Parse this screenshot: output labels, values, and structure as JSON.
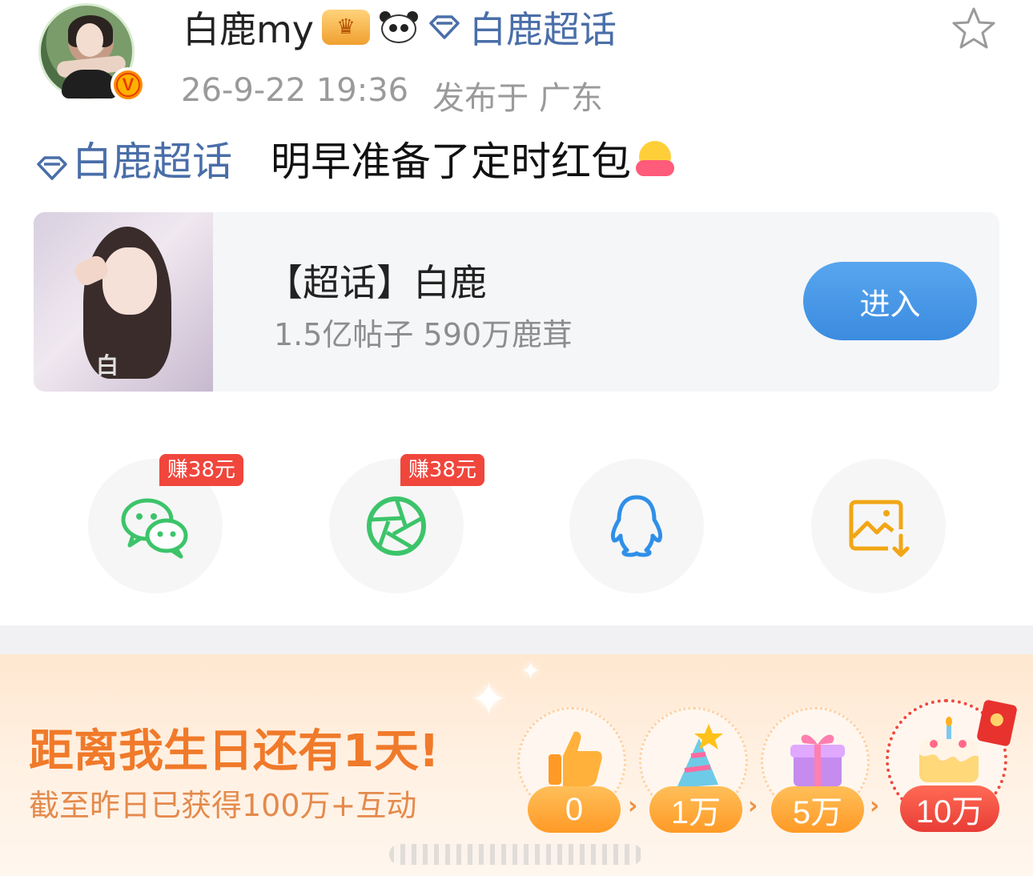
{
  "post": {
    "username": "白鹿my",
    "vip_badge_icon": "vip-crown-badge-icon",
    "panda_badge_icon": "panda-badge-icon",
    "topic_icon": "diamond-icon",
    "topic_name": "白鹿超话",
    "timestamp": "26-9-22 19:36",
    "location": "发布于 广东",
    "verified_badge": "V",
    "body_topic": "白鹿超话",
    "body_text": "明早准备了定时红包",
    "emoji_icon": "hugging-face-icon"
  },
  "card": {
    "title": "【超话】白鹿",
    "stats": "1.5亿帖子 590万鹿茸",
    "thumb_watermark": "白",
    "enter_label": "进入"
  },
  "share": {
    "items": [
      {
        "name": "wechat",
        "icon": "wechat-icon",
        "tag": "赚38元",
        "color": "#3cc46a"
      },
      {
        "name": "moments",
        "icon": "moments-shutter-icon",
        "tag": "赚38元",
        "color": "#3cc46a"
      },
      {
        "name": "qq",
        "icon": "qq-penguin-icon",
        "tag": "",
        "color": "#2f8fe8"
      },
      {
        "name": "save-image",
        "icon": "save-image-icon",
        "tag": "",
        "color": "#f2a615"
      }
    ]
  },
  "banner": {
    "title": "距离我生日还有1天!",
    "subtitle": "截至昨日已获得100万+互动",
    "milestones": [
      {
        "label": "0",
        "icon": "thumbs-up-icon"
      },
      {
        "label": "1万",
        "icon": "party-hat-icon"
      },
      {
        "label": "5万",
        "icon": "gift-box-icon"
      },
      {
        "label": "10万",
        "icon": "birthday-cake-icon"
      }
    ],
    "accent": "#f07a2a"
  }
}
